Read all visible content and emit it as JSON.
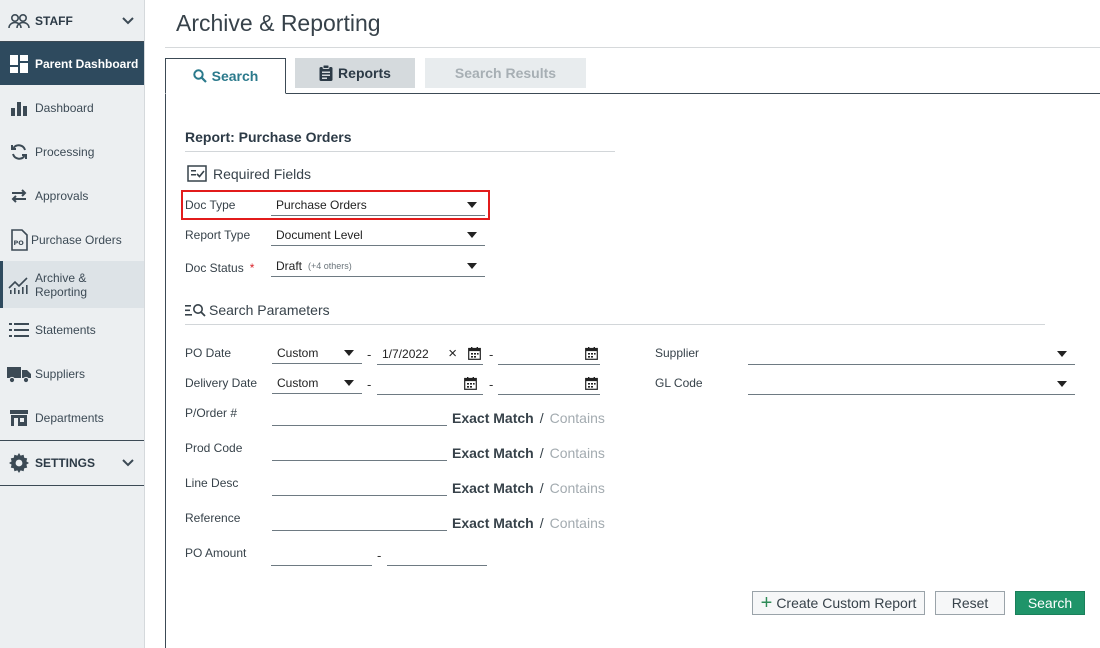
{
  "sidebar": {
    "staff": "STAFF",
    "items": [
      {
        "label": "Parent Dashboard",
        "icon": "dashboard-grid-icon"
      },
      {
        "label": "Dashboard",
        "icon": "bar-chart-icon"
      },
      {
        "label": "Processing",
        "icon": "refresh-icon"
      },
      {
        "label": "Approvals",
        "icon": "swap-arrows-icon"
      },
      {
        "label": "Purchase Orders",
        "icon": "po-document-icon"
      },
      {
        "label": "Archive &",
        "label2": "Reporting",
        "icon": "trend-chart-icon"
      },
      {
        "label": "Statements",
        "icon": "list-icon"
      },
      {
        "label": "Suppliers",
        "icon": "truck-icon"
      },
      {
        "label": "Departments",
        "icon": "building-icon"
      }
    ],
    "settings": "SETTINGS"
  },
  "page": {
    "title": "Archive & Reporting"
  },
  "tabs": {
    "search": "Search",
    "reports": "Reports",
    "results": "Search Results"
  },
  "report": {
    "title": "Report: Purchase Orders"
  },
  "required": {
    "heading": "Required Fields",
    "doc_type_label": "Doc Type",
    "doc_type_value": "Purchase Orders",
    "report_type_label": "Report Type",
    "report_type_value": "Document Level",
    "doc_status_label": "Doc Status",
    "doc_status_required": "*",
    "doc_status_value": "Draft",
    "doc_status_extra": "(+4 others)"
  },
  "params": {
    "heading": "Search Parameters",
    "po_date_label": "PO Date",
    "po_date_mode": "Custom",
    "po_date_from": "1/7/2022",
    "po_date_to": "",
    "delivery_date_label": "Delivery Date",
    "delivery_date_mode": "Custom",
    "delivery_date_from": "",
    "delivery_date_to": "",
    "dash": "-",
    "supplier_label": "Supplier",
    "supplier_value": "",
    "gl_code_label": "GL Code",
    "gl_code_value": "",
    "porder_label": "P/Order #",
    "prod_code_label": "Prod Code",
    "line_desc_label": "Line Desc",
    "reference_label": "Reference",
    "po_amount_label": "PO Amount",
    "exact": "Exact Match",
    "sep": "/",
    "contains": "Contains"
  },
  "buttons": {
    "custom": "Create Custom Report",
    "plus": "+",
    "reset": "Reset",
    "search": "Search"
  },
  "colors": {
    "sidebar_active": "#2e4a5e",
    "accent_teal": "#2b7a8c",
    "search_button": "#1f9469",
    "highlight": "#e21b1b"
  }
}
